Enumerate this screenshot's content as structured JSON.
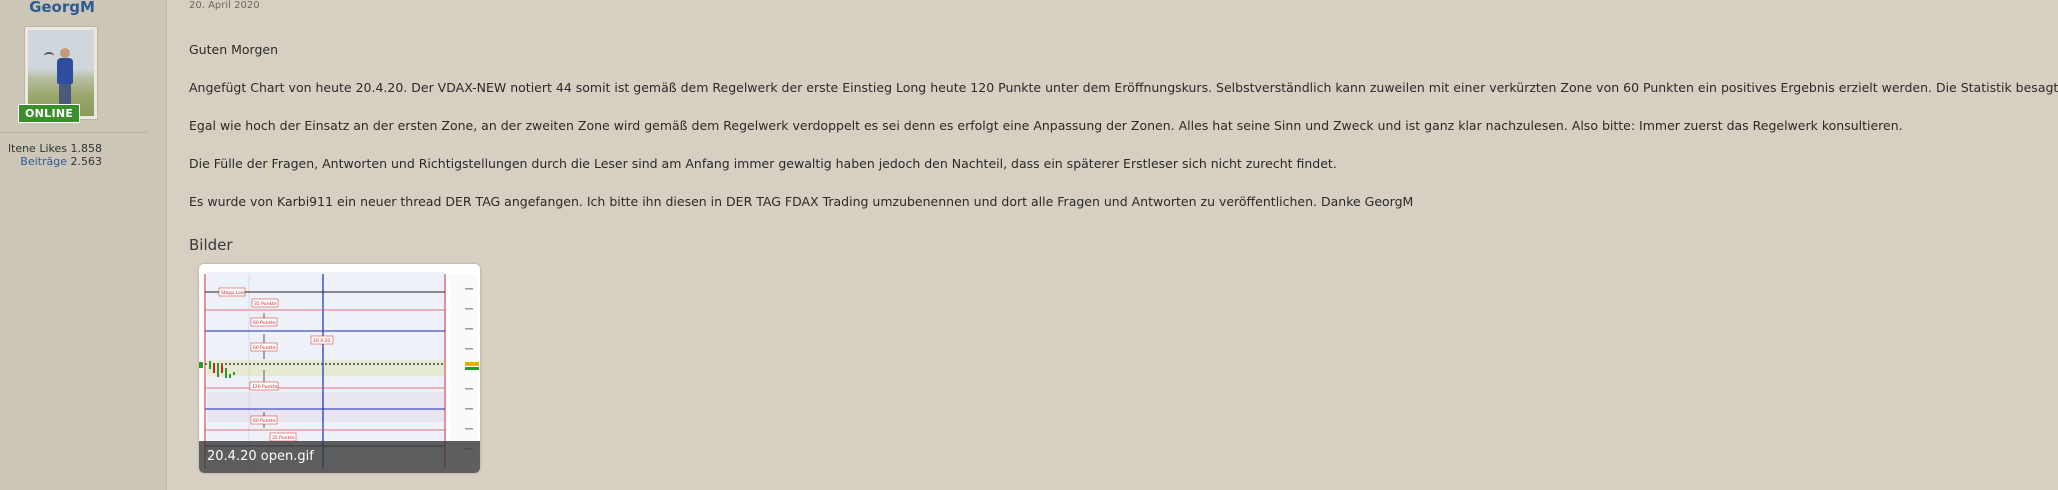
{
  "user": {
    "name": "GeorgM",
    "status": "ONLINE",
    "stats": [
      {
        "label": "ltene Likes",
        "value": "1.858"
      },
      {
        "label": "Beiträge",
        "value": "2.563"
      }
    ]
  },
  "post": {
    "date": "20. April 2020",
    "paragraphs": [
      "Guten Morgen",
      "Angefügt Chart von heute 20.4.20. Der VDAX-NEW notiert 44 somit ist gemäß dem Regelwerk der erste Einstieg Long heute 120 Punkte unter dem Eröffnungskurs. Selbstverständlich kann zuweilen mit einer verkürzten Zone von 60 Punkten ein positives Ergebnis erzielt werden. Die Statistik besagt jedoch: Gefahr!",
      "Egal wie hoch der Einsatz an der ersten Zone, an der zweiten Zone wird gemäß dem Regelwerk verdoppelt es sei denn es erfolgt eine Anpassung der Zonen. Alles hat seine Sinn und Zweck und ist ganz klar nachzulesen. Also bitte: Immer zuerst das Regelwerk konsultieren.",
      "Die Fülle der Fragen, Antworten und Richtigstellungen durch die Leser sind am Anfang immer gewaltig haben jedoch den Nachteil, dass ein späterer Erstleser sich nicht zurecht findet.",
      "Es wurde von Karbi911 ein neuer thread DER TAG angefangen. Ich bitte ihn diesen in DER TAG FDAX Trading umzubenennen und dort alle Fragen und Antworten zu veröffentlichen. Danke GeorgM"
    ],
    "attachments_heading": "Bilder",
    "attachment": {
      "filename": "20.4.20 open.gif",
      "labels": [
        "Stopp Loss",
        "35 Punkte",
        "60 Punkte",
        "60 Punkte",
        "20.4.20",
        "120 Punkte",
        "60 Punkte",
        "35 Punkte"
      ]
    }
  },
  "colors": {
    "background": "#d6cfc2",
    "sidebar": "#ccc6b8",
    "link": "#2d5b94",
    "online": "#3a8f2c"
  }
}
